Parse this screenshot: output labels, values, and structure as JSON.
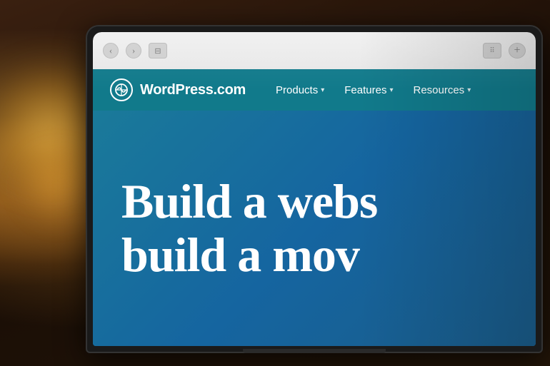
{
  "scene": {
    "background_color": "#2a1a0a"
  },
  "browser": {
    "back_btn": "‹",
    "forward_btn": "›",
    "tab_icon": "⊟",
    "grid_icon": "⋯",
    "new_tab_icon": "+"
  },
  "wordpress": {
    "logo_symbol": "W",
    "brand_name": "WordPress.com",
    "nav": {
      "products_label": "Products",
      "features_label": "Features",
      "resources_label": "Resources"
    },
    "hero": {
      "line1": "Build a webs",
      "line2": "build a mov"
    }
  }
}
